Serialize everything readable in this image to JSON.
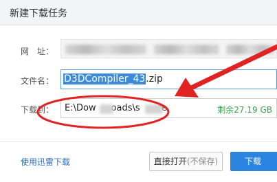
{
  "window": {
    "title": "新建下载任务"
  },
  "form": {
    "url_label": "网　址：",
    "filename_label": "文件名：",
    "filename_selected": "D3DCompiler_43",
    "filename_ext": ".zip",
    "download_to_label": "下载到：",
    "path_start": "E:\\Dow",
    "path_mid": "oads\\s",
    "path_end": "re",
    "space_remaining": "剩余27.19 GB"
  },
  "footer": {
    "xunlei_link": "使用迅雷下载",
    "open_direct_label": "直接打开",
    "open_direct_note": "(不保存)",
    "download_button": "下载"
  },
  "annotation_colors": {
    "highlight": "#e02424"
  }
}
